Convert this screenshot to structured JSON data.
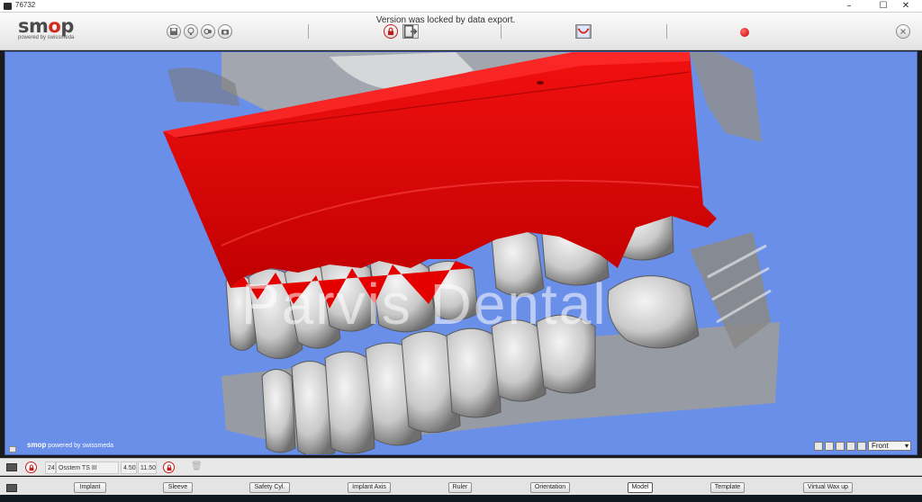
{
  "window": {
    "title": "76732",
    "controls": [
      "–",
      "☐",
      "✕"
    ]
  },
  "toolbar": {
    "logo_word_start": "sm",
    "logo_word_o": "o",
    "logo_word_end": "p",
    "logo_sub": "powered by swissmeda",
    "status_message": "Version was locked by data export.",
    "icons": [
      "save-icon",
      "lightbulb-icon",
      "settings-icon",
      "camera-icon",
      "lock-icon",
      "export-icon",
      "curve-view-icon",
      "record-icon",
      "close-icon"
    ]
  },
  "viewport": {
    "watermark": "Parvis Dental",
    "brand_prefix": "smop",
    "brand_suffix": "powered by swissmeda",
    "view_mode": "Front",
    "colors": {
      "background": "#6a8fe8",
      "guide": "#e80000",
      "teeth": "#d9d9d9"
    }
  },
  "implant": {
    "position": "24",
    "name": "Osstem TS III Fixture",
    "diameter": "4.50",
    "length": "11.50"
  },
  "buttons": [
    "Implant",
    "Sleeve",
    "Safety Cyl.",
    "Implant Axis",
    "Ruler",
    "Orientation",
    "Model",
    "Template",
    "Virtual Wax up"
  ],
  "active_button": "Model"
}
